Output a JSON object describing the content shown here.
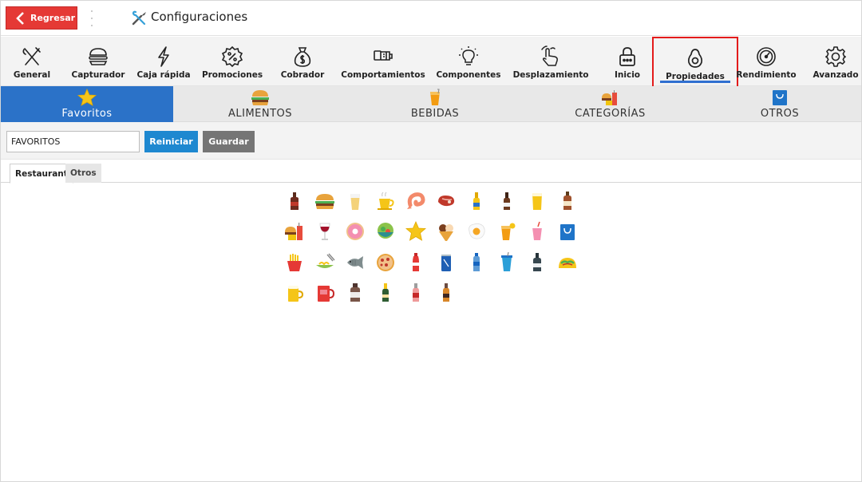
{
  "header": {
    "back_label": "Regresar",
    "title": "Configuraciones",
    "title_icon": "tools-icon"
  },
  "toolbar": {
    "items": [
      {
        "label": "General",
        "icon": "fork-knife-icon"
      },
      {
        "label": "Capturador",
        "icon": "burger-icon"
      },
      {
        "label": "Caja rápida",
        "icon": "lightning-icon"
      },
      {
        "label": "Promociones",
        "icon": "discount-badge-icon"
      },
      {
        "label": "Cobrador",
        "icon": "money-bag-icon"
      },
      {
        "label": "Comportamientos",
        "icon": "hand-card-icon"
      },
      {
        "label": "Componentes",
        "icon": "lightbulb-icon"
      },
      {
        "label": "Desplazamiento",
        "icon": "swipe-hand-icon"
      },
      {
        "label": "Inicio",
        "icon": "lock-icon"
      },
      {
        "label": "Propiedades",
        "icon": "avocado-icon"
      },
      {
        "label": "Rendimiento",
        "icon": "gauge-icon"
      },
      {
        "label": "Avanzado",
        "icon": "gear-icon"
      }
    ],
    "active_index": 9
  },
  "categories": [
    {
      "label": "Favoritos",
      "icon": "star-icon",
      "active": true
    },
    {
      "label": "ALIMENTOS",
      "icon": "burger-icon",
      "active": false
    },
    {
      "label": "BEBIDAS",
      "icon": "juice-icon",
      "active": false
    },
    {
      "label": "CATEGORÍAS",
      "icon": "food-combo-icon",
      "active": false
    },
    {
      "label": "OTROS",
      "icon": "shopping-bag-icon",
      "active": false
    }
  ],
  "form": {
    "name_value": "FAVORITOS",
    "reset_label": "Reiniciar",
    "save_label": "Guardar"
  },
  "subtabs": {
    "active_label": "Restaurant",
    "other_label": "Otros"
  },
  "icons": [
    "liquor-bottle-icon",
    "burger-icon",
    "beer-glass-icon",
    "coffee-cup-icon",
    "shrimp-icon",
    "steak-icon",
    "beer-bottle-yellow-icon",
    "beer-bottle-brown-icon",
    "beer-pint-icon",
    "whiskey-bottle-icon",
    "food-combo-icon",
    "wine-glass-icon",
    "donut-icon",
    "salad-bowl-icon",
    "star-icon",
    "ice-cream-icon",
    "fried-egg-icon",
    "juice-icon",
    "milkshake-icon",
    "shopping-bag-icon",
    "fries-icon",
    "noodles-icon",
    "fish-icon",
    "pizza-icon",
    "soda-bottle-icon",
    "soda-can-icon",
    "water-bottle-icon",
    "soda-cup-icon",
    "dark-bottle-icon",
    "taco-icon",
    "beer-mug-icon",
    "red-mug-icon",
    "brown-jar-icon",
    "champagne-bottle-icon",
    "red-bottle-icon",
    "amber-bottle-icon"
  ]
}
